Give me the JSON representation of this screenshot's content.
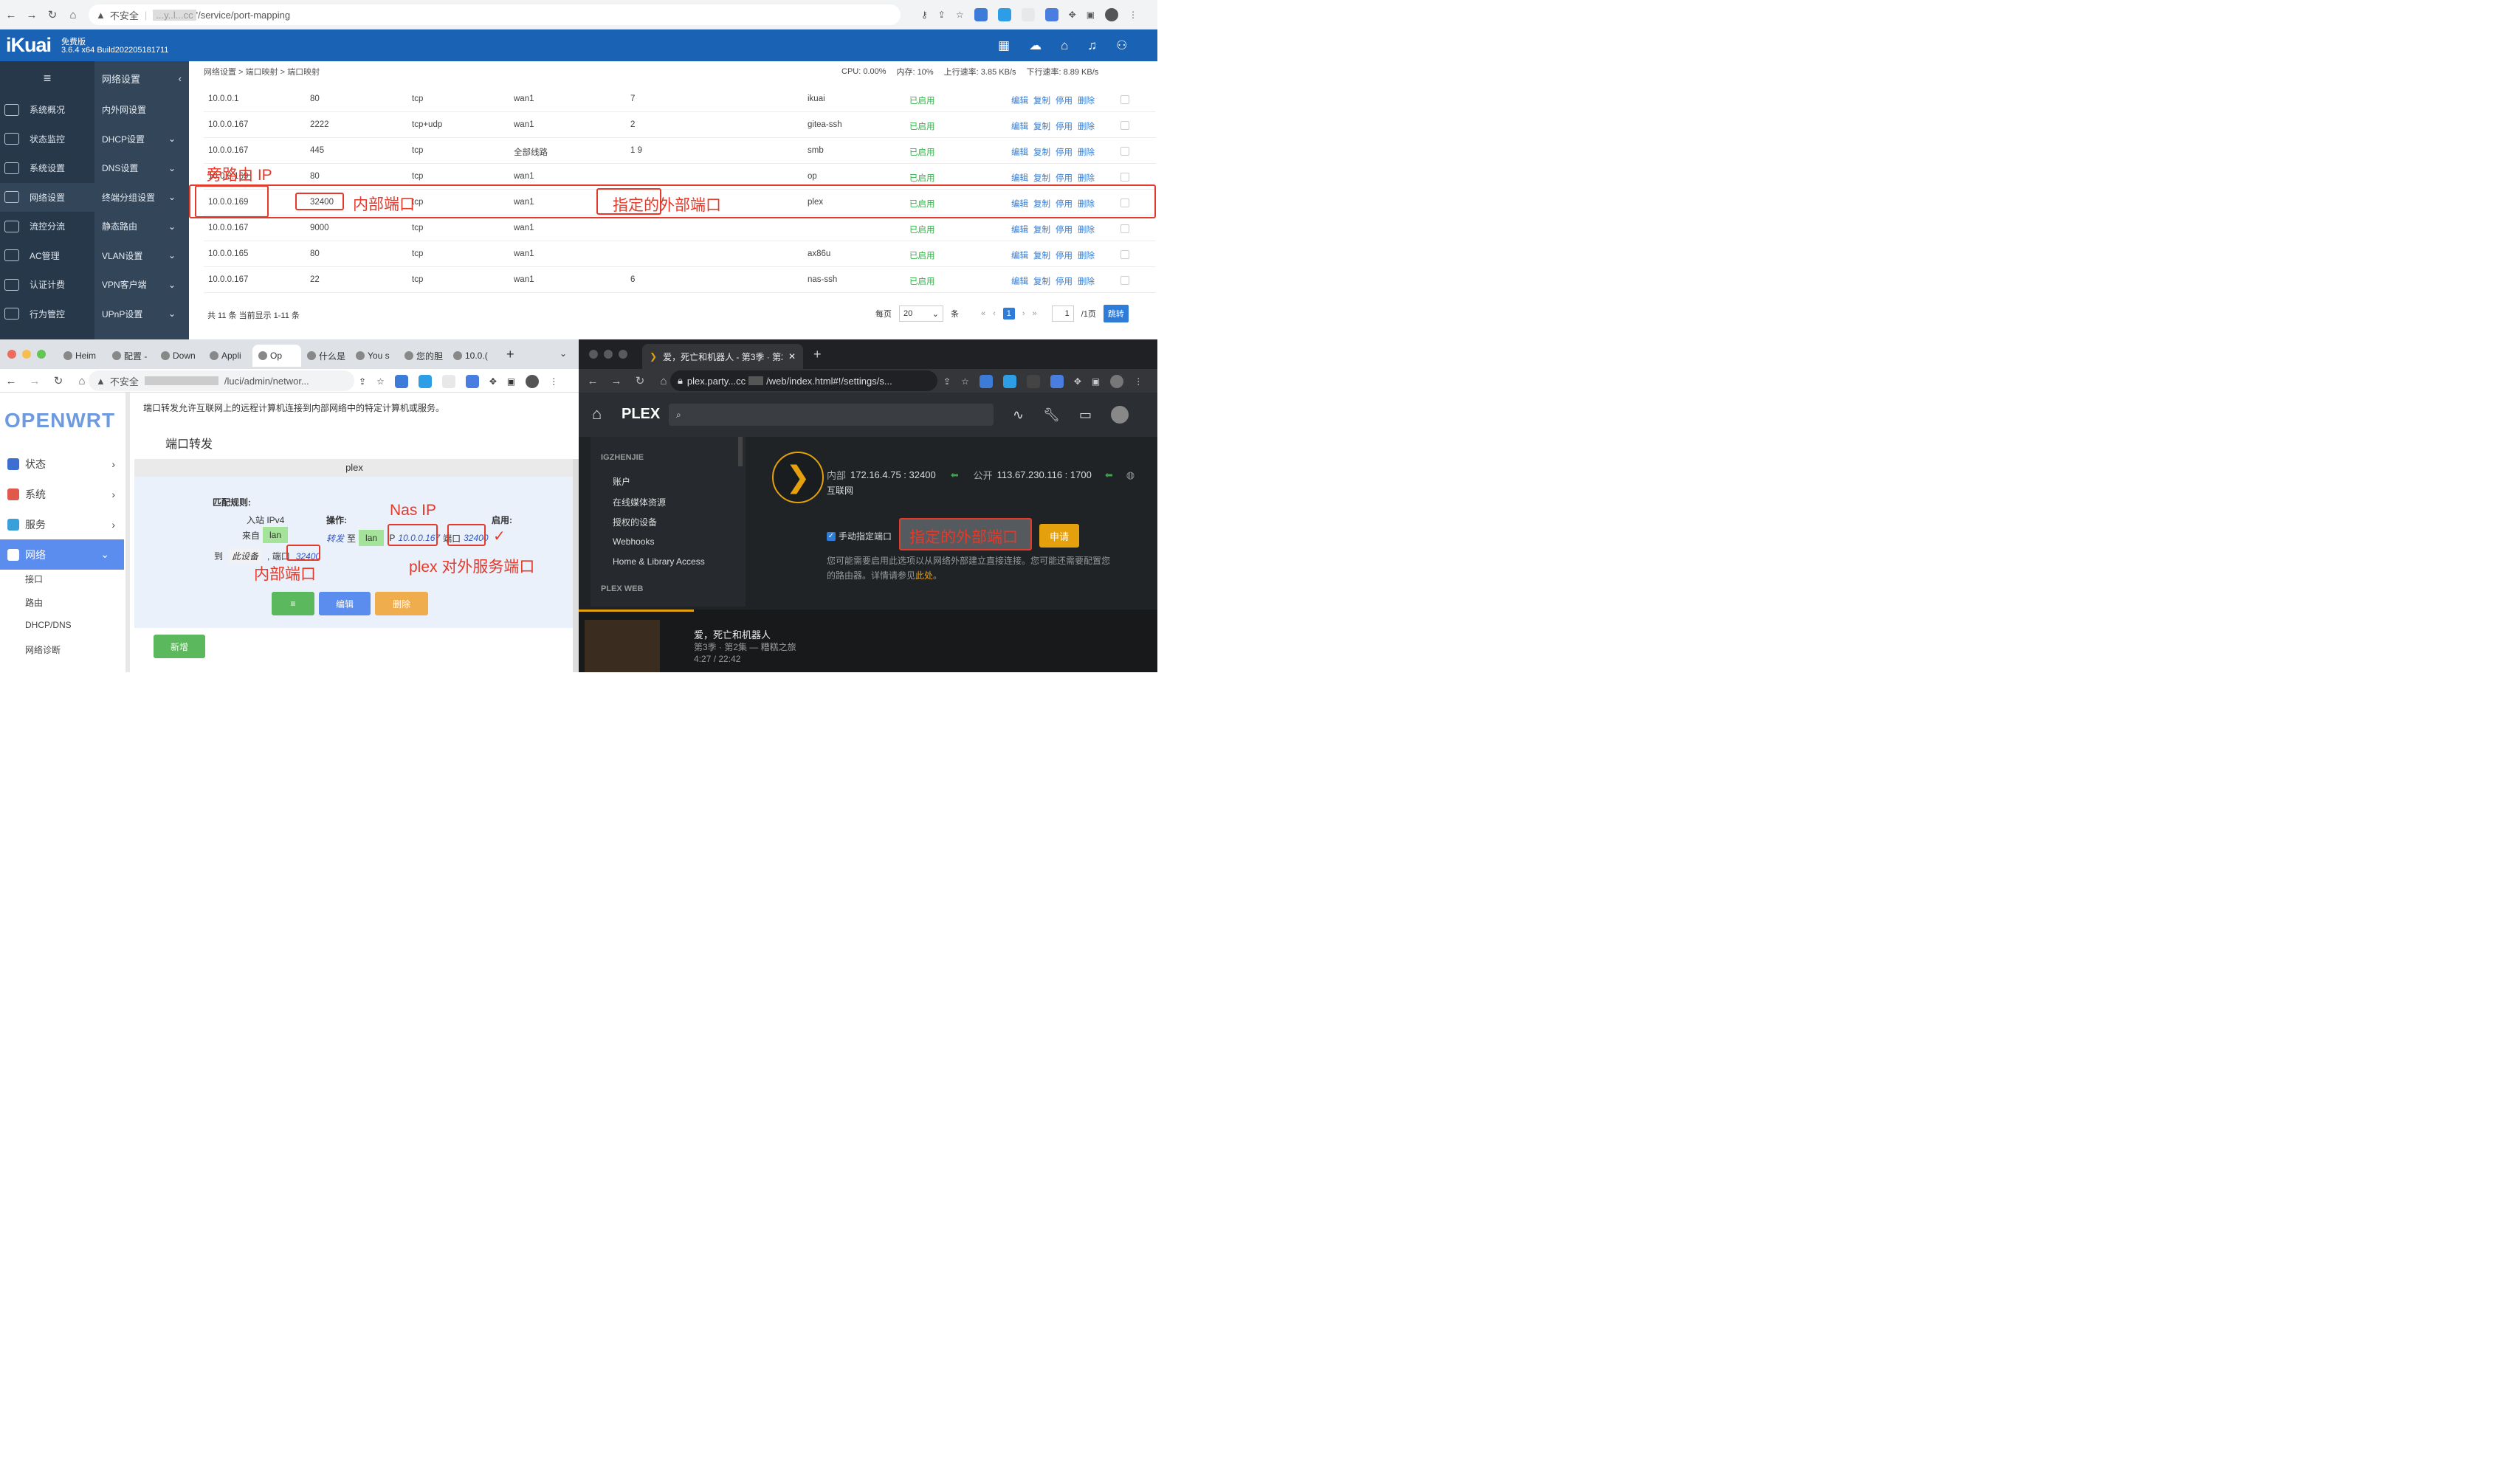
{
  "top_browser": {
    "security": "不安全",
    "url_host": "...y..l...cc",
    "url_path": "'/service/port-mapping"
  },
  "ikuai": {
    "logo": "iKuai",
    "edition": "免费版",
    "build": "3.6.4 x64 Build202205181711",
    "breadcrumb": "网络设置 > 端口映射 > 端口映射",
    "status": {
      "cpu": "CPU: 0.00%",
      "mem": "内存: 10%",
      "up": "上行速率: 3.85 KB/s",
      "down": "下行速率: 8.89 KB/s"
    },
    "nav_title": "网络设置",
    "sidebar1": [
      "系统概况",
      "状态监控",
      "系统设置",
      "网络设置",
      "流控分流",
      "AC管理",
      "认证计费",
      "行为管控"
    ],
    "sidebar2": [
      "内外网设置",
      "DHCP设置",
      "DNS设置",
      "终端分组设置",
      "静态路由",
      "VLAN设置",
      "VPN客户端",
      "UPnP设置"
    ],
    "rows": [
      {
        "ip": "10.0.0.1",
        "port": "80",
        "proto": "tcp",
        "line": "wan1",
        "ext": "7",
        "name": "ikuai",
        "status": "已启用"
      },
      {
        "ip": "10.0.0.167",
        "port": "2222",
        "proto": "tcp+udp",
        "line": "wan1",
        "ext": "2",
        "name": "gitea-ssh",
        "status": "已启用"
      },
      {
        "ip": "10.0.0.167",
        "port": "445",
        "proto": "tcp",
        "line": "全部线路",
        "ext": "1  9",
        "name": "smb",
        "status": "已启用"
      },
      {
        "ip": "10.0.0.169",
        "port": "80",
        "proto": "tcp",
        "line": "wan1",
        "ext": "",
        "name": "op",
        "status": "已启用"
      },
      {
        "ip": "10.0.0.169",
        "port": "32400",
        "proto": "tcp",
        "line": "wan1",
        "ext": "",
        "name": "plex",
        "status": "已启用"
      },
      {
        "ip": "10.0.0.167",
        "port": "9000",
        "proto": "tcp",
        "line": "wan1",
        "ext": "",
        "name": "",
        "status": "已启用"
      },
      {
        "ip": "10.0.0.165",
        "port": "80",
        "proto": "tcp",
        "line": "wan1",
        "ext": "",
        "name": "ax86u",
        "status": "已启用"
      },
      {
        "ip": "10.0.0.167",
        "port": "22",
        "proto": "tcp",
        "line": "wan1",
        "ext": "6",
        "name": "nas-ssh",
        "status": "已启用"
      }
    ],
    "ops": {
      "edit": "编辑",
      "copy": "复制",
      "stop": "停用",
      "delete": "删除"
    },
    "footer": {
      "total": "共 11 条 当前显示 1-11 条",
      "per_page": "每页",
      "per_page_value": "20",
      "unit": "条",
      "current_page": "1",
      "goto_value": "1",
      "pages": "/1页",
      "jump": "跳转"
    },
    "annotations": {
      "router_ip": "旁路由 IP",
      "internal_port": "内部端口",
      "external_port": "指定的外部端口"
    }
  },
  "openwrt_browser": {
    "tabs": [
      "Heim",
      "配置 -",
      "Down",
      "Appli",
      "Op",
      "什么是",
      "You s",
      "您的胆",
      "10.0.("
    ],
    "security": "不安全",
    "url_path": "/luci/admin/networ..."
  },
  "openwrt": {
    "logo": "OPENWRT",
    "menu": [
      "状态",
      "系统",
      "服务",
      "网络"
    ],
    "submenu": [
      "接口",
      "路由",
      "DHCP/DNS",
      "网络诊断"
    ],
    "desc": "端口转发允许互联网上的远程计算机连接到内部网络中的特定计算机或服务。",
    "section": "端口转发",
    "rule_name": "plex",
    "match_label": "匹配规则:",
    "inbound": "入站 IPv4",
    "from": "来自",
    "zone_lan": "lan",
    "to": "到",
    "this_device": "此设备",
    "port_prefix": ", 端口",
    "port": "32400",
    "action_label": "操作:",
    "forward": "转发",
    "forward_to": "至",
    "ip_prefix": "IP",
    "nas_ip": "10.0.0.167",
    "port_prefix2": "端口",
    "port2": "32400",
    "enabled_label": "启用:",
    "btn_drag": "≡",
    "btn_edit": "编辑",
    "btn_delete": "删除",
    "btn_add": "新增",
    "annotations": {
      "nas_ip": "Nas IP",
      "internal_port": "内部端口",
      "plex_port": "plex 对外服务端口"
    }
  },
  "plex_browser": {
    "tab_title": "爱，死亡和机器人 - 第3季 · 第2",
    "url_host": "plex.party...cc",
    "url_path": "/web/index.html#!/settings/s..."
  },
  "plex": {
    "logo": "PLEX",
    "server_name": "IGZHENJIE",
    "menu": [
      "账户",
      "在线媒体资源",
      "授权的设备",
      "Webhooks",
      "Home & Library Access"
    ],
    "web_section": "PLEX WEB",
    "internal_label": "内部",
    "internal_addr": "172.16.4.75 : 32400",
    "public_label": "公开",
    "public_addr": "113.67.230.116 : 1700",
    "internet": "互联网",
    "manual_port": "手动指定端口",
    "apply": "申请",
    "ext_port_annotation": "指定的外部端口",
    "hint": "您可能需要启用此选项以从网络外部建立直接连接。您可能还需要配置您的路由器。详情请参见",
    "hint_link": "此处",
    "hint_end": "。",
    "now_playing_title": "爱，死亡和机器人",
    "now_playing_sub": "第3季 · 第2集 — 糟糕之旅",
    "now_playing_time": "4:27 / 22:42"
  },
  "colors": {
    "ikuai_blue": "#1a62b4",
    "annotation_red": "#e33a2b",
    "enabled_green": "#35b24a",
    "plex_orange": "#e5a00d"
  }
}
